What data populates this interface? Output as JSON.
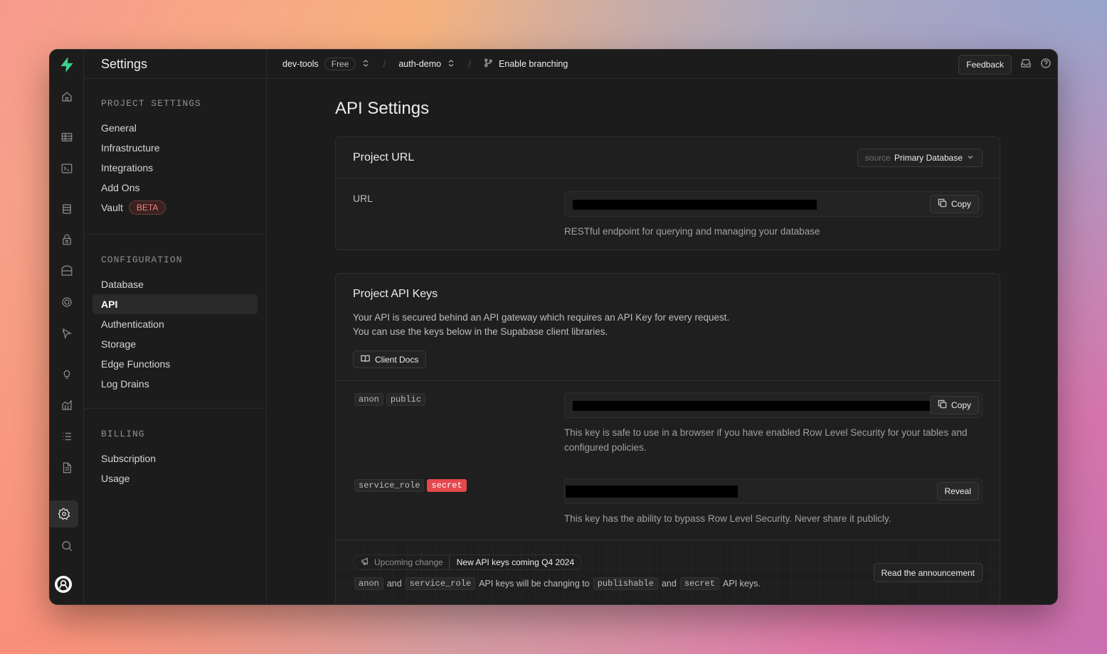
{
  "sidebar": {
    "title": "Settings",
    "project_settings_title": "PROJECT SETTINGS",
    "project_items": [
      "General",
      "Infrastructure",
      "Integrations",
      "Add Ons",
      "Vault"
    ],
    "vault_badge": "BETA",
    "configuration_title": "CONFIGURATION",
    "configuration_items": [
      "Database",
      "API",
      "Authentication",
      "Storage",
      "Edge Functions",
      "Log Drains"
    ],
    "active_item": "API",
    "billing_title": "BILLING",
    "billing_items": [
      "Subscription",
      "Usage"
    ]
  },
  "topbar": {
    "org": "dev-tools",
    "plan": "Free",
    "project": "auth-demo",
    "branching": "Enable branching",
    "feedback": "Feedback"
  },
  "main": {
    "page_title": "API Settings",
    "project_url": {
      "title": "Project URL",
      "source_label": "source",
      "source_value": "Primary Database",
      "url_label": "URL",
      "copy": "Copy",
      "help": "RESTful endpoint for querying and managing your database"
    },
    "api_keys": {
      "title": "Project API Keys",
      "desc_line1": "Your API is secured behind an API gateway which requires an API Key for every request.",
      "desc_line2": "You can use the keys below in the Supabase client libraries.",
      "docs_button": "Client Docs",
      "anon_tag": "anon",
      "public_tag": "public",
      "copy": "Copy",
      "anon_help": "This key is safe to use in a browser if you have enabled Row Level Security for your tables and configured policies.",
      "service_tag": "service_role",
      "secret_tag": "secret",
      "reveal": "Reveal",
      "service_help": "This key has the ability to bypass Row Level Security. Never share it publicly."
    },
    "notice": {
      "lead": "Upcoming change",
      "value": "New API keys coming Q4 2024",
      "t_anon": "anon",
      "t_and1": "and",
      "t_service": "service_role",
      "t_mid": "API keys will be changing to",
      "t_publishable": "publishable",
      "t_and2": "and",
      "t_secret": "secret",
      "t_end": "API keys.",
      "read_button": "Read the announcement"
    }
  },
  "colors": {
    "brand": "#3ecf8e",
    "danger": "#e5484d",
    "background": "#1c1c1c"
  },
  "icons": {
    "rail": [
      "home-icon",
      "table-editor-icon",
      "sql-editor-icon",
      "database-icon",
      "auth-lock-icon",
      "storage-icon",
      "realtime-icon",
      "edge-functions-icon",
      "advisors-icon",
      "reports-icon",
      "logs-icon",
      "docs-icon",
      "settings-icon",
      "search-icon"
    ]
  }
}
